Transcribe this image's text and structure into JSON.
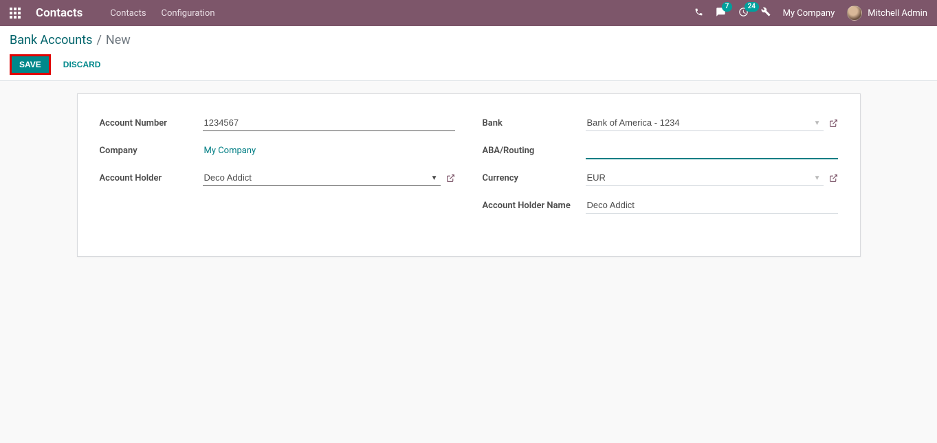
{
  "navbar": {
    "brand": "Contacts",
    "menu": {
      "contacts": "Contacts",
      "configuration": "Configuration"
    },
    "messages_badge": "7",
    "activities_badge": "24",
    "company": "My Company",
    "user": "Mitchell Admin"
  },
  "breadcrumb": {
    "parent": "Bank Accounts",
    "sep": "/",
    "current": "New"
  },
  "buttons": {
    "save": "Save",
    "discard": "Discard"
  },
  "form": {
    "left": {
      "account_number_label": "Account Number",
      "account_number_value": "1234567",
      "company_label": "Company",
      "company_value": "My Company",
      "account_holder_label": "Account Holder",
      "account_holder_value": "Deco Addict"
    },
    "right": {
      "bank_label": "Bank",
      "bank_value": "Bank of America - 1234",
      "aba_label": "ABA/Routing",
      "aba_value": "",
      "currency_label": "Currency",
      "currency_value": "EUR",
      "holder_name_label": "Account Holder Name",
      "holder_name_value": "Deco Addict"
    }
  }
}
